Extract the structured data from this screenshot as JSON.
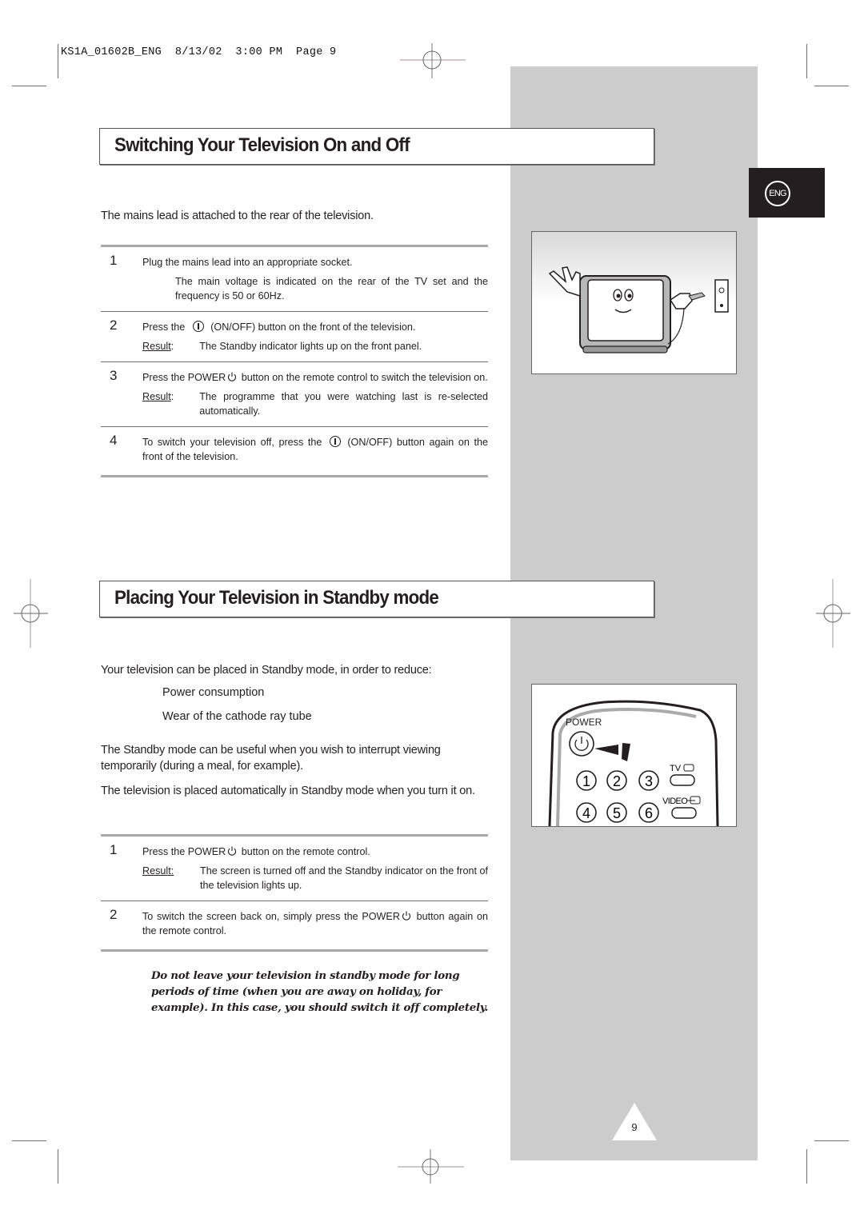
{
  "slug": "KS1A_01602B_ENG  8/13/02  3:00 PM  Page 9",
  "language_badge": "ENG",
  "section1": {
    "title": "Switching Your Television On and Off",
    "intro": "The mains lead is attached to the rear of the television.",
    "steps": [
      {
        "number": "1",
        "text": "Plug the mains lead into an appropriate socket.",
        "sub": "The main voltage is indicated on the rear of the TV set and the frequency is 50 or 60Hz."
      },
      {
        "number": "2",
        "text_before": "Press the",
        "text_after": "(ON/OFF) button on the front of the television.",
        "result_label": "Result",
        "result_colon": ":",
        "result_text": "The Standby indicator lights up on the front panel."
      },
      {
        "number": "3",
        "text_before": "Press the POWER",
        "text_after": " button on the remote control to switch the television on.",
        "result_label": "Result",
        "result_colon": ":",
        "result_text": "The programme that you were watching last is re-selected automatically."
      },
      {
        "number": "4",
        "text_before": "To switch your television off, press the",
        "text_after": "(ON/OFF) button again on the front of the television."
      }
    ],
    "illustration": "tv-plugging-into-socket"
  },
  "section2": {
    "title": "Placing Your Television in Standby mode",
    "intro": "Your television can be placed in Standby mode, in order to reduce:",
    "bullets": [
      "Power consumption",
      "Wear of the cathode ray tube"
    ],
    "para1": "The Standby mode can be useful when you wish to interrupt viewing temporarily (during a meal, for example).",
    "para2": "The television is placed automatically in Standby mode when you turn it on.",
    "steps": [
      {
        "number": "1",
        "text_before": "Press the POWER",
        "text_after": " button on the remote control.",
        "result_label": "Result:",
        "result_text": "The screen is turned off and the Standby indicator on the front of the television lights up."
      },
      {
        "number": "2",
        "text_before": "To switch the screen back on, simply press the POWER",
        "text_after": " button again on the remote control."
      }
    ],
    "note": "Do not leave your television in standby mode for long periods of time (when you are away on holiday, for example). In this case, you should switch it off completely.",
    "remote": {
      "power_label": "POWER",
      "tv_label": "TV",
      "video_label": "VIDEO",
      "keys": [
        "1",
        "2",
        "3",
        "4",
        "5",
        "6"
      ]
    }
  },
  "page_number": "9"
}
